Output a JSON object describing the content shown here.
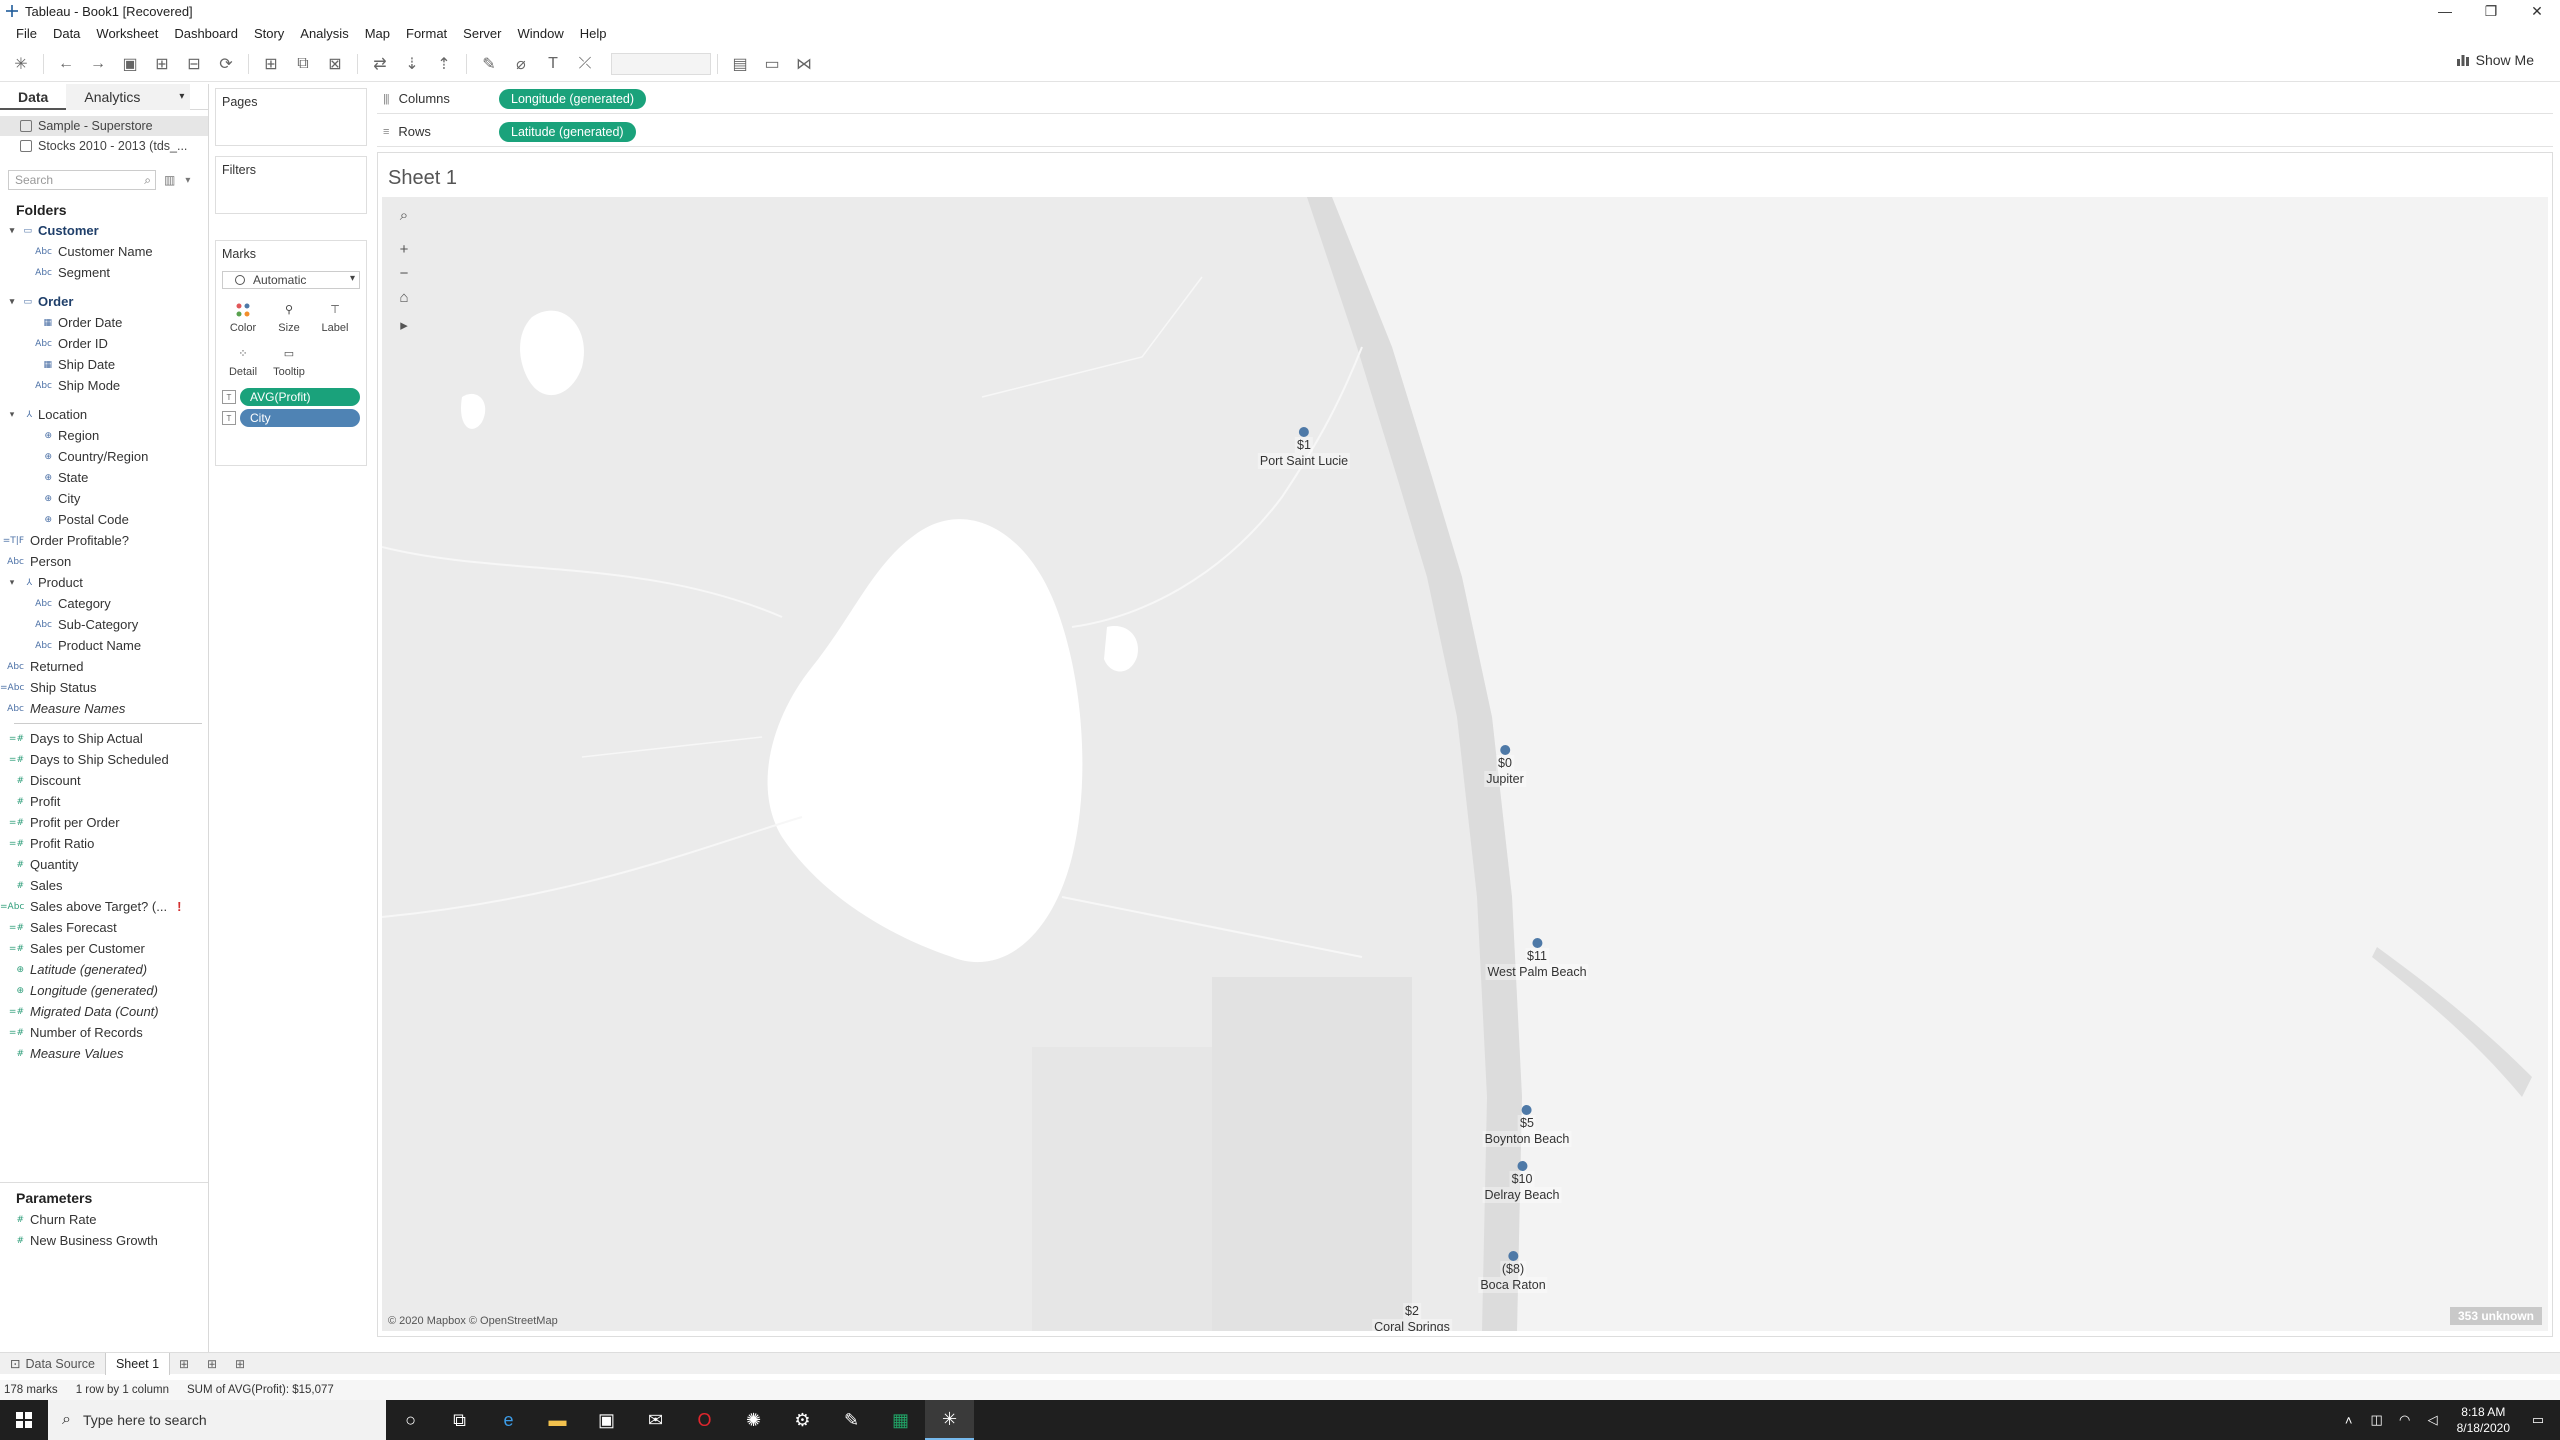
{
  "window": {
    "title": "Tableau - Book1 [Recovered]"
  },
  "menu": [
    "File",
    "Data",
    "Worksheet",
    "Dashboard",
    "Story",
    "Analysis",
    "Map",
    "Format",
    "Server",
    "Window",
    "Help"
  ],
  "toolbar": {
    "show_me": "Show Me"
  },
  "data_pane": {
    "tabs": [
      "Data",
      "Analytics"
    ],
    "data_sources": [
      "Sample - Superstore",
      "Stocks 2010 - 2013 (tds_..."
    ],
    "search_placeholder": "Search",
    "folders_title": "Folders",
    "fields": [
      {
        "label": "Customer",
        "type": "folder",
        "icon": "▭"
      },
      {
        "label": "Customer Name",
        "type": "dim",
        "icon": "Abc"
      },
      {
        "label": "Segment",
        "type": "dim",
        "icon": "Abc"
      },
      {
        "label": "",
        "type": "gap"
      },
      {
        "label": "Order",
        "type": "folder",
        "icon": "▭"
      },
      {
        "label": "Order Date",
        "type": "dim",
        "icon": "▦"
      },
      {
        "label": "Order ID",
        "type": "dim",
        "icon": "Abc"
      },
      {
        "label": "Ship Date",
        "type": "dim",
        "icon": "▦"
      },
      {
        "label": "Ship Mode",
        "type": "dim",
        "icon": "Abc"
      },
      {
        "label": "",
        "type": "gap"
      },
      {
        "label": "Location",
        "type": "hier",
        "icon": "⅄"
      },
      {
        "label": "Region",
        "type": "geo",
        "icon": "⊕"
      },
      {
        "label": "Country/Region",
        "type": "geo",
        "icon": "⊕"
      },
      {
        "label": "State",
        "type": "geo",
        "icon": "⊕"
      },
      {
        "label": "City",
        "type": "geo",
        "icon": "⊕"
      },
      {
        "label": "Postal Code",
        "type": "geo",
        "icon": "⊕"
      },
      {
        "label": "Order Profitable?",
        "type": "top",
        "icon": "=T|F"
      },
      {
        "label": "Person",
        "type": "top",
        "icon": "Abc"
      },
      {
        "label": "Product",
        "type": "hier",
        "icon": "⅄"
      },
      {
        "label": "Category",
        "type": "dim",
        "icon": "Abc"
      },
      {
        "label": "Sub-Category",
        "type": "dim",
        "icon": "Abc"
      },
      {
        "label": "Product Name",
        "type": "dim",
        "icon": "Abc"
      },
      {
        "label": "Returned",
        "type": "top",
        "icon": "Abc"
      },
      {
        "label": "Ship Status",
        "type": "top",
        "icon": "=Abc"
      },
      {
        "label": "Measure Names",
        "type": "top-italic",
        "icon": "Abc"
      },
      {
        "label": "",
        "type": "sep"
      },
      {
        "label": "Days to Ship Actual",
        "type": "meas",
        "icon": "=#"
      },
      {
        "label": "Days to Ship Scheduled",
        "type": "meas",
        "icon": "=#"
      },
      {
        "label": "Discount",
        "type": "meas",
        "icon": "#"
      },
      {
        "label": "Profit",
        "type": "meas",
        "icon": "#"
      },
      {
        "label": "Profit per Order",
        "type": "meas",
        "icon": "=#"
      },
      {
        "label": "Profit Ratio",
        "type": "meas",
        "icon": "=#"
      },
      {
        "label": "Quantity",
        "type": "meas",
        "icon": "#"
      },
      {
        "label": "Sales",
        "type": "meas",
        "icon": "#"
      },
      {
        "label": "Sales above Target? (...",
        "type": "meas-warn",
        "icon": "=Abc"
      },
      {
        "label": "Sales Forecast",
        "type": "meas",
        "icon": "=#"
      },
      {
        "label": "Sales per Customer",
        "type": "meas",
        "icon": "=#"
      },
      {
        "label": "Latitude (generated)",
        "type": "meas-italic",
        "icon": "⊕"
      },
      {
        "label": "Longitude (generated)",
        "type": "meas-italic",
        "icon": "⊕"
      },
      {
        "label": "Migrated Data (Count)",
        "type": "meas-italic",
        "icon": "=#"
      },
      {
        "label": "Number of Records",
        "type": "meas",
        "icon": "=#"
      },
      {
        "label": "Measure Values",
        "type": "meas-italic",
        "icon": "#"
      }
    ],
    "parameters_title": "Parameters",
    "parameters": [
      "Churn Rate",
      "New Business Growth"
    ]
  },
  "cards": {
    "pages": "Pages",
    "filters": "Filters",
    "marks": "Marks",
    "mark_type": "Automatic",
    "buttons": [
      "Color",
      "Size",
      "Label",
      "Detail",
      "Tooltip"
    ],
    "pills": [
      "AVG(Profit)",
      "City"
    ]
  },
  "shelves": {
    "columns_label": "Columns",
    "columns_pill": "Longitude (generated)",
    "rows_label": "Rows",
    "rows_pill": "Latitude (generated)"
  },
  "sheet": {
    "title": "Sheet 1",
    "attribution": "© 2020 Mapbox © OpenStreetMap",
    "unknown_badge": "353 unknown",
    "cities": [
      {
        "name": "Port Saint Lucie",
        "value": "$1"
      },
      {
        "name": "Jupiter",
        "value": "$0"
      },
      {
        "name": "West Palm Beach",
        "value": "$11"
      },
      {
        "name": "Boynton Beach",
        "value": "$5"
      },
      {
        "name": "Delray Beach",
        "value": "$10"
      },
      {
        "name": "Boca Raton",
        "value": "($8)"
      },
      {
        "name": "Coral Springs",
        "value": "$2"
      }
    ]
  },
  "sheet_tabs": {
    "data_source": "Data Source",
    "sheet": "Sheet 1"
  },
  "status": {
    "marks": "178 marks",
    "rowscols": "1 row by 1 column",
    "sum": "SUM of AVG(Profit): $15,077"
  },
  "taskbar": {
    "search_placeholder": "Type here to search",
    "time": "8:18 AM",
    "date": "8/18/2020"
  }
}
